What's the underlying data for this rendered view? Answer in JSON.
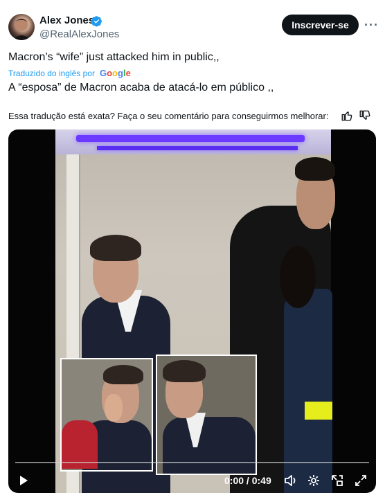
{
  "author": {
    "name": "Alex Jones",
    "handle": "@RealAlexJones",
    "verified": true
  },
  "header": {
    "subscribe_label": "Inscrever-se",
    "more_icon": "more-dots-icon"
  },
  "tweet": {
    "original_text": "Macron’s “wife” just attacked him in public,,",
    "translated_by_label": "Traduzido do inglês por",
    "translator_brand": "Google",
    "translated_text": "A “esposa” de Macron acaba de atacá-lo em público ,,",
    "feedback_prompt": "Essa tradução está exata? Faça o seu comentário para conseguirmos melhorar:"
  },
  "video": {
    "current_time": "0:00",
    "separator": "/",
    "duration": "0:49",
    "progress_fraction": 0.0,
    "controls": [
      "play-icon",
      "volume-icon",
      "settings-gear-icon",
      "pip-icon",
      "fullscreen-icon"
    ]
  },
  "colors": {
    "accent": "#1d9bf0",
    "text_primary": "#0f1419",
    "text_secondary": "#536471",
    "button_dark": "#0f1419"
  }
}
